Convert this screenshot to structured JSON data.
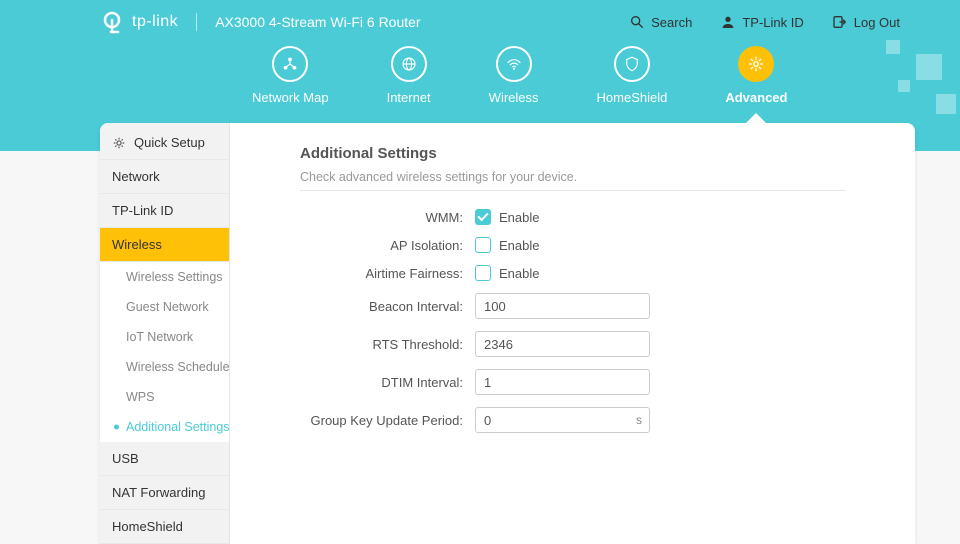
{
  "brand": "tp-link",
  "product": "AX3000 4-Stream Wi-Fi 6 Router",
  "actions": {
    "search": "Search",
    "tplink_id": "TP-Link ID",
    "logout": "Log Out"
  },
  "nav": [
    {
      "label": "Network Map",
      "icon": "network-map-icon"
    },
    {
      "label": "Internet",
      "icon": "globe-icon"
    },
    {
      "label": "Wireless",
      "icon": "wifi-icon"
    },
    {
      "label": "HomeShield",
      "icon": "shield-icon"
    },
    {
      "label": "Advanced",
      "icon": "gear-icon"
    }
  ],
  "sidebar": {
    "quick_setup": "Quick Setup",
    "items": [
      "Network",
      "TP-Link ID",
      "Wireless",
      "USB",
      "NAT Forwarding",
      "HomeShield"
    ],
    "wireless_sub": [
      "Wireless Settings",
      "Guest Network",
      "IoT Network",
      "Wireless Schedule",
      "WPS",
      "Additional Settings"
    ]
  },
  "content": {
    "title": "Additional Settings",
    "desc": "Check advanced wireless settings for your device.",
    "labels": {
      "wmm": "WMM:",
      "ap_isolation": "AP Isolation:",
      "airtime_fairness": "Airtime Fairness:",
      "beacon_interval": "Beacon Interval:",
      "rts_threshold": "RTS Threshold:",
      "dtim_interval": "DTIM Interval:",
      "group_key": "Group Key Update Period:",
      "enable": "Enable"
    },
    "values": {
      "wmm": true,
      "ap_isolation": false,
      "airtime_fairness": false,
      "beacon_interval": "100",
      "rts_threshold": "2346",
      "dtim_interval": "1",
      "group_key": "0",
      "group_key_unit": "s"
    }
  }
}
